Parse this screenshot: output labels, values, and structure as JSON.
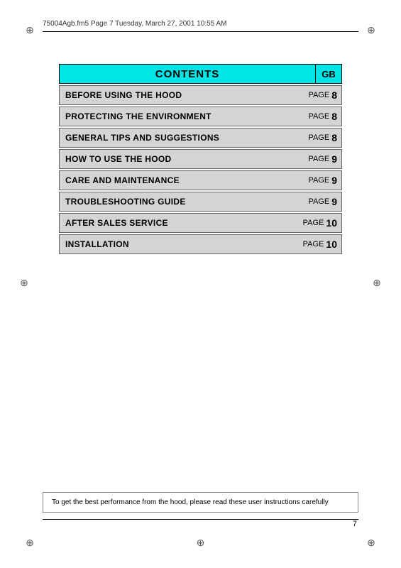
{
  "header": {
    "file_info": "75004Agb.fm5  Page 7  Tuesday, March 27, 2001  10:55 AM"
  },
  "contents": {
    "title": "CONTENTS",
    "gb_label": "GB",
    "rows": [
      {
        "label": "BEFORE USING THE HOOD",
        "page_word": "PAGE",
        "page_num": "8"
      },
      {
        "label": "PROTECTING THE ENVIRONMENT",
        "page_word": "PAGE",
        "page_num": "8"
      },
      {
        "label": "GENERAL TIPS AND SUGGESTIONS",
        "page_word": "PAGE",
        "page_num": "8"
      },
      {
        "label": "HOW TO USE THE HOOD",
        "page_word": "PAGE",
        "page_num": "9"
      },
      {
        "label": "CARE AND MAINTENANCE",
        "page_word": "PAGE",
        "page_num": "9"
      },
      {
        "label": "TROUBLESHOOTING GUIDE",
        "page_word": "PAGE",
        "page_num": "9"
      },
      {
        "label": "AFTER SALES SERVICE",
        "page_word": "PAGE",
        "page_num": "10"
      },
      {
        "label": "INSTALLATION",
        "page_word": "PAGE",
        "page_num": "10"
      }
    ]
  },
  "bottom_note": {
    "text": "To get the best performance from the hood, please read these user instructions carefully"
  },
  "page_number": "7"
}
